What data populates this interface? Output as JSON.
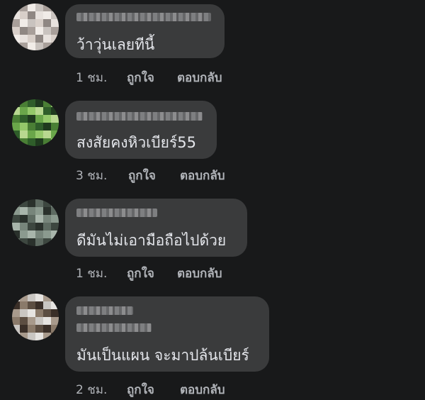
{
  "comments": [
    {
      "text": "ว้าวุ่นเลยทีนี้",
      "time": "1 ชม.",
      "like": "ถูกใจ",
      "reply": "ตอบกลับ"
    },
    {
      "text": "สงสัยคงหิวเบียร์55",
      "time": "3 ชม.",
      "like": "ถูกใจ",
      "reply": "ตอบกลับ"
    },
    {
      "text": "ดีมันไม่เอามือถือไปด้วย",
      "time": "1 ชม.",
      "like": "ถูกใจ",
      "reply": "ตอบกลับ"
    },
    {
      "text": "มันเป็นแผน จะมาปล้นเบียร์",
      "time": "2 ชม.",
      "like": "ถูกใจ",
      "reply": "ตอบกลับ"
    }
  ],
  "avatar_palettes": [
    [
      "#c9c3bf",
      "#e8e2de",
      "#a89f9a",
      "#d8cfc9",
      "#f1ece8",
      "#8f8783"
    ],
    [
      "#6aa64a",
      "#2f5e2a",
      "#94c86a",
      "#1f3a1e",
      "#b8d890",
      "#4a7f35"
    ],
    [
      "#5e6b62",
      "#8b9a8f",
      "#3d4740",
      "#a8b5ab",
      "#2a312c",
      "#77857b"
    ],
    [
      "#8a7a6a",
      "#c9c6c2",
      "#5c4e42",
      "#e6e4e1",
      "#3a2f28",
      "#a89a8c"
    ]
  ]
}
